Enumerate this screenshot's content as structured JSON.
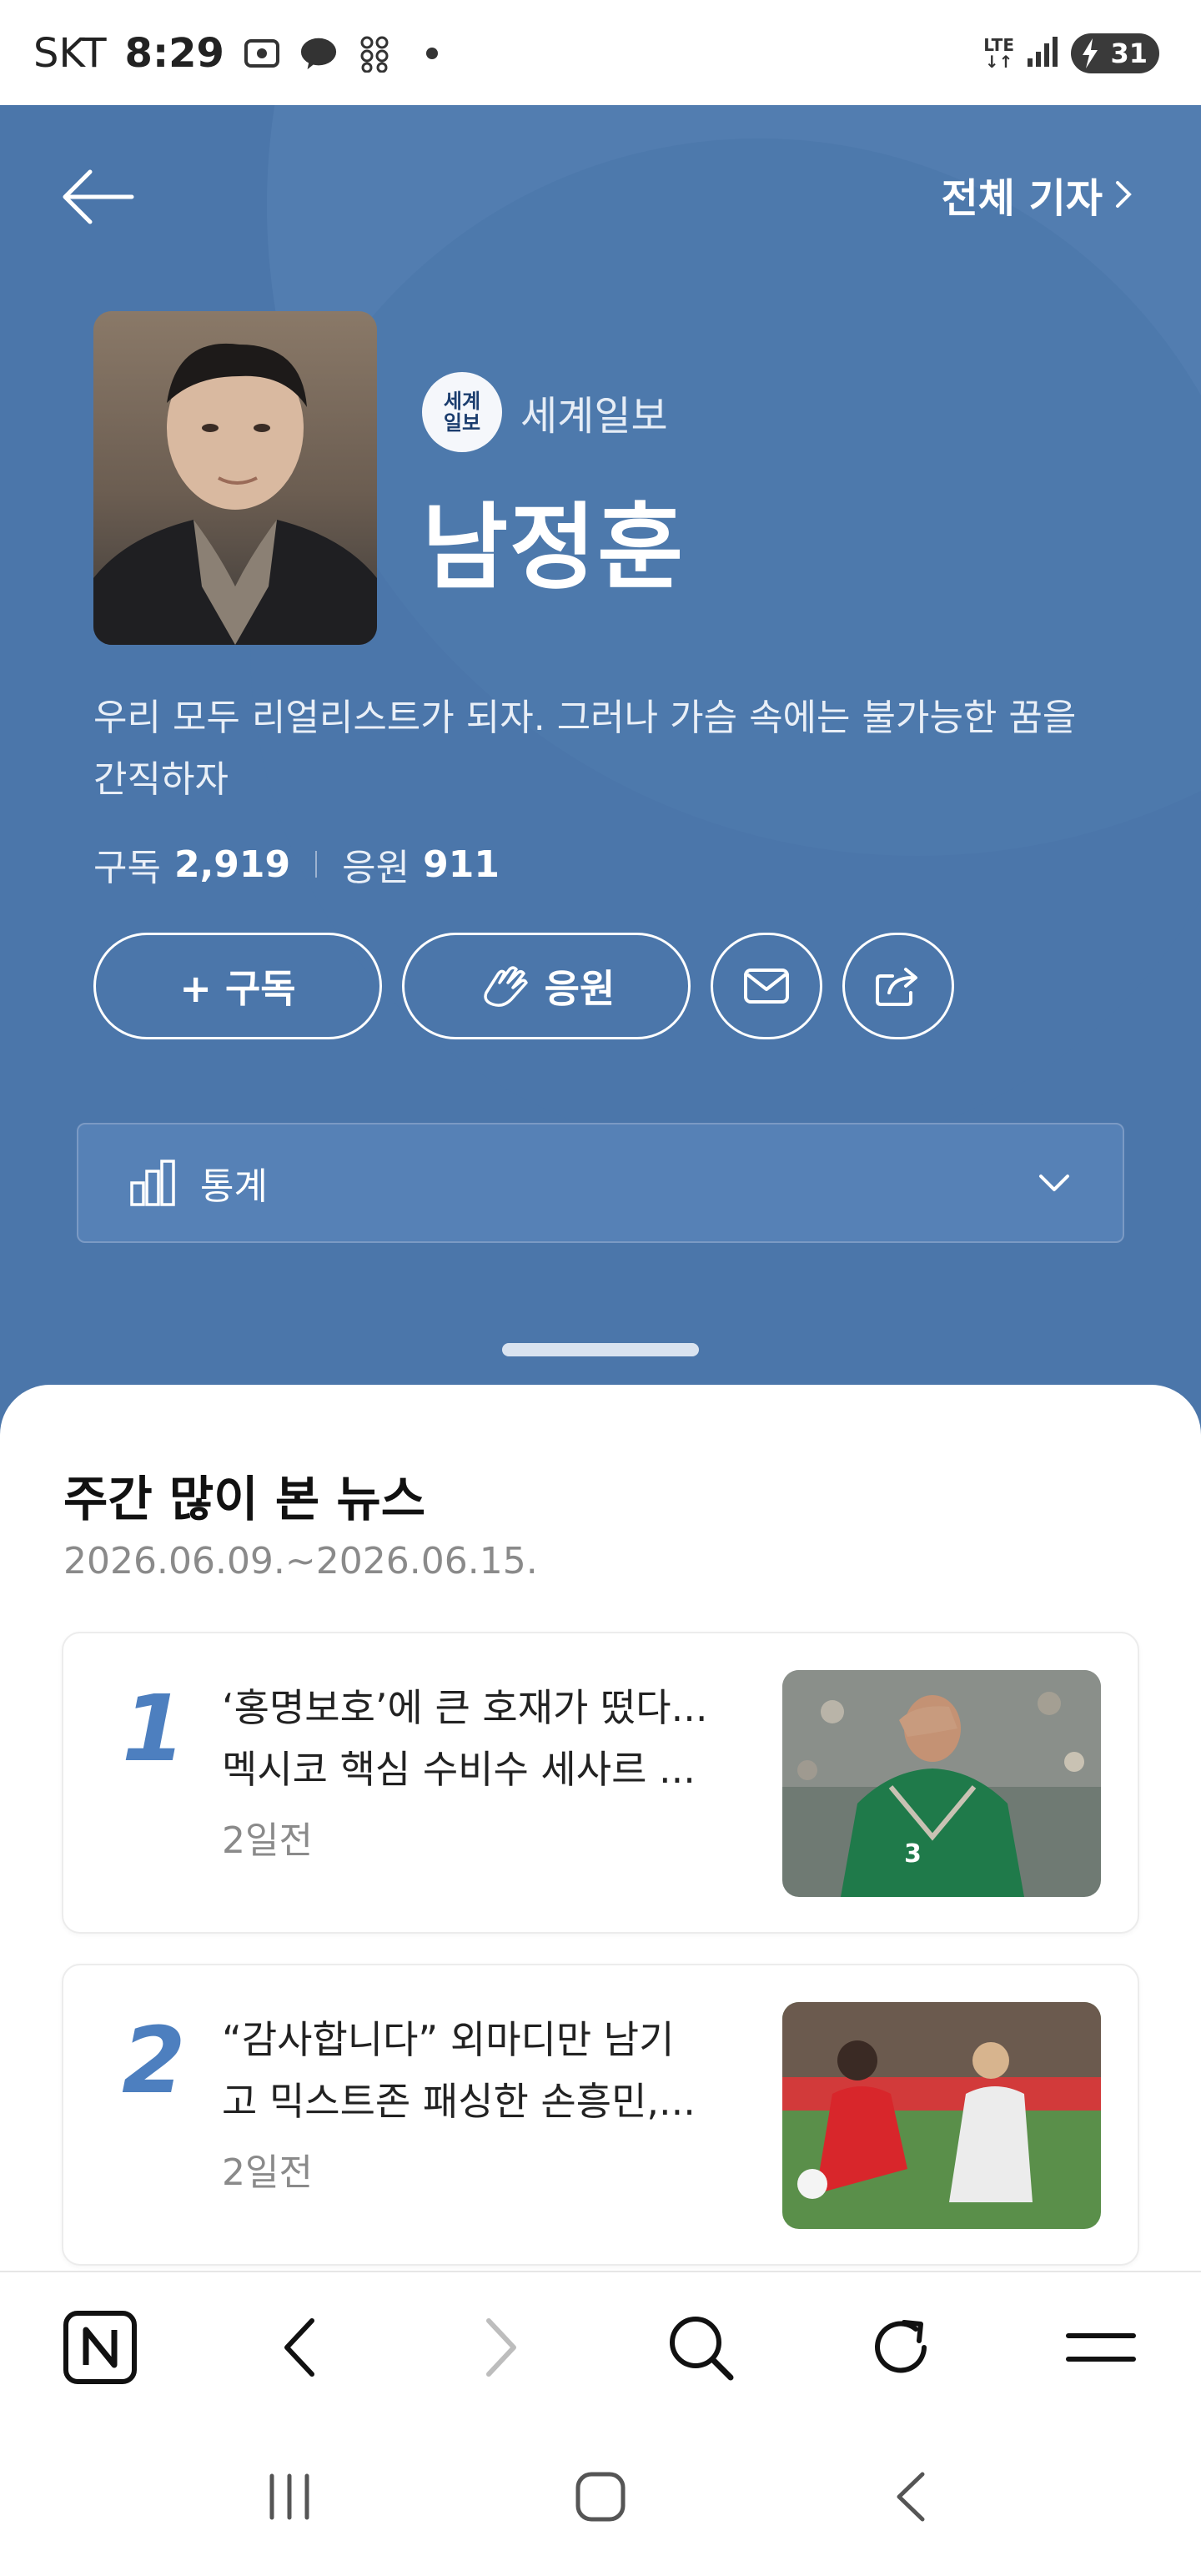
{
  "status_bar": {
    "carrier": "SKT",
    "time": "8:29",
    "talk_badge": "TALK",
    "network": "LTE",
    "battery": "31"
  },
  "header": {
    "all_reporters_label": "전체 기자"
  },
  "profile": {
    "press_logo_text_line1": "세계",
    "press_logo_text_line2": "일보",
    "press_name": "세계일보",
    "reporter_name": "남정훈",
    "bio": "우리 모두 리얼리스트가 되자. 그러나 가슴 속에는 불가능한 꿈을 간직하자",
    "subscribe_label": "구독",
    "subscribe_count": "2,919",
    "cheer_label": "응원",
    "cheer_count": "911"
  },
  "actions": {
    "subscribe_button": "+ 구독",
    "cheer_button": "응원"
  },
  "stats_panel": {
    "label": "통계"
  },
  "weekly_news": {
    "title": "주간 많이 본 뉴스",
    "date_range": "2026.06.09.~2026.06.15.",
    "items": [
      {
        "rank": "1",
        "title_line1": "‘홍명보호’에 큰 호재가 떴다...",
        "title_line2": "멕시코 핵심 수비수 세사르 ...",
        "time_ago": "2일전"
      },
      {
        "rank": "2",
        "title_line1": "“감사합니다” 외마디만 남기",
        "title_line2": "고 믹스트존 패싱한 손흥민,...",
        "time_ago": "2일전"
      }
    ]
  },
  "colors": {
    "hero_bg": "#4b76aa",
    "rank_blue": "#4d7fbf"
  }
}
